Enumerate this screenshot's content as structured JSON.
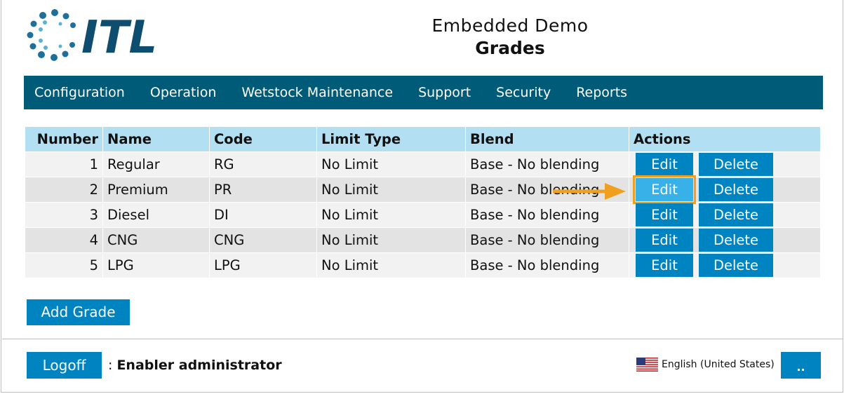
{
  "header": {
    "logo_text": "ITL",
    "app_title": "Embedded Demo",
    "page_title": "Grades"
  },
  "nav": {
    "items": [
      {
        "label": "Configuration"
      },
      {
        "label": "Operation"
      },
      {
        "label": "Wetstock Maintenance"
      },
      {
        "label": "Support"
      },
      {
        "label": "Security"
      },
      {
        "label": "Reports"
      }
    ]
  },
  "grades_table": {
    "headers": [
      "Number",
      "Name",
      "Code",
      "Limit Type",
      "Blend",
      "Actions"
    ],
    "rows": [
      {
        "number": "1",
        "name": "Regular",
        "code": "RG",
        "limit_type": "No Limit",
        "blend": "Base - No blending",
        "edit": "Edit",
        "delete": "Delete"
      },
      {
        "number": "2",
        "name": "Premium",
        "code": "PR",
        "limit_type": "No Limit",
        "blend": "Base - No blending",
        "edit": "Edit",
        "delete": "Delete"
      },
      {
        "number": "3",
        "name": "Diesel",
        "code": "DI",
        "limit_type": "No Limit",
        "blend": "Base - No blending",
        "edit": "Edit",
        "delete": "Delete"
      },
      {
        "number": "4",
        "name": "CNG",
        "code": "CNG",
        "limit_type": "No Limit",
        "blend": "Base - No blending",
        "edit": "Edit",
        "delete": "Delete"
      },
      {
        "number": "5",
        "name": "LPG",
        "code": "LPG",
        "limit_type": "No Limit",
        "blend": "Base - No blending",
        "edit": "Edit",
        "delete": "Delete"
      }
    ],
    "highlighted_row": 2
  },
  "actions": {
    "add_grade_label": "Add Grade"
  },
  "footer": {
    "logoff_label": "Logoff",
    "user_prefix": ": ",
    "user_name": "Enabler administrator",
    "language": "English (United States)",
    "more_label": ".."
  },
  "colors": {
    "nav_background": "#005b78",
    "button": "#0084c1",
    "highlight_button": "#38b0e8",
    "annotation": "#f0a020",
    "table_header": "#b3dff2"
  },
  "icons": {
    "logo": "itl-logo",
    "annotation_arrow": "arrow-right-icon",
    "language_flag": "us-flag-icon"
  }
}
